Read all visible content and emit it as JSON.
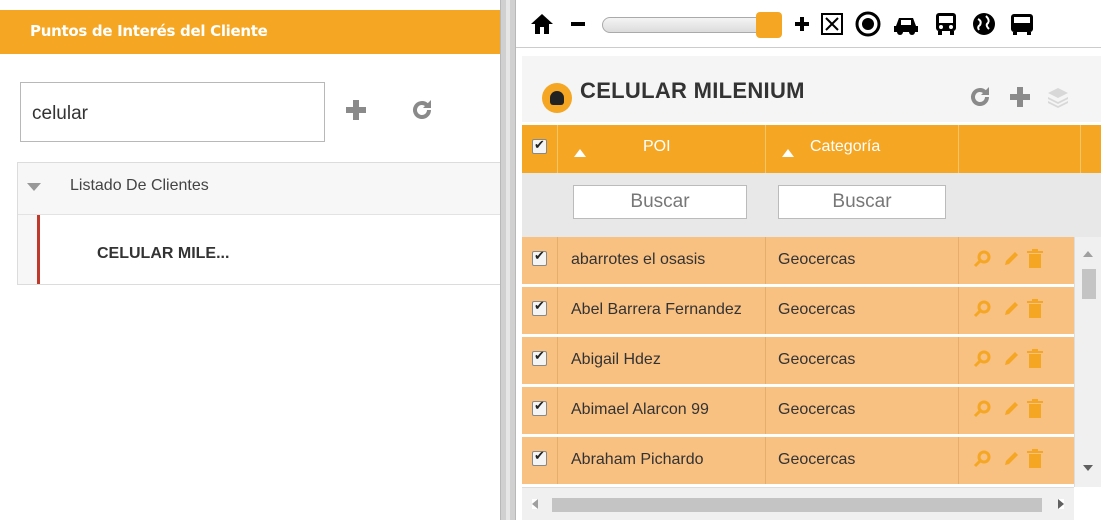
{
  "left_panel": {
    "title": "Puntos de Interés del Cliente",
    "search_value": "celular",
    "add_icon": "plus-icon",
    "refresh_icon": "refresh-icon",
    "tree": {
      "root_label": "Listado De Clientes",
      "child_label": "CELULAR MILE..."
    }
  },
  "toolbar": {
    "icons": [
      "home-icon",
      "minus-icon",
      "zoom-slider",
      "plus-icon",
      "fullscreen-icon",
      "target-icon",
      "car-icon",
      "bus-icon",
      "globe-icon",
      "truck-icon"
    ],
    "zoom_level": 0.92
  },
  "grid": {
    "client_title": "CELULAR MILENIUM",
    "columns": [
      "POI",
      "Categoría"
    ],
    "filter_placeholder": "Buscar",
    "rows": [
      {
        "poi": "abarrotes el osasis",
        "categoria": "Geocercas",
        "checked": true
      },
      {
        "poi": "Abel Barrera Fernandez",
        "categoria": "Geocercas",
        "checked": true
      },
      {
        "poi": "Abigail Hdez",
        "categoria": "Geocercas",
        "checked": true
      },
      {
        "poi": "Abimael Alarcon 99",
        "categoria": "Geocercas",
        "checked": true
      },
      {
        "poi": "Abraham Pichardo",
        "categoria": "Geocercas",
        "checked": true
      }
    ]
  },
  "colors": {
    "accent": "#f5a623",
    "row_bg": "#f8c081",
    "tree_marker": "#c0392b"
  }
}
